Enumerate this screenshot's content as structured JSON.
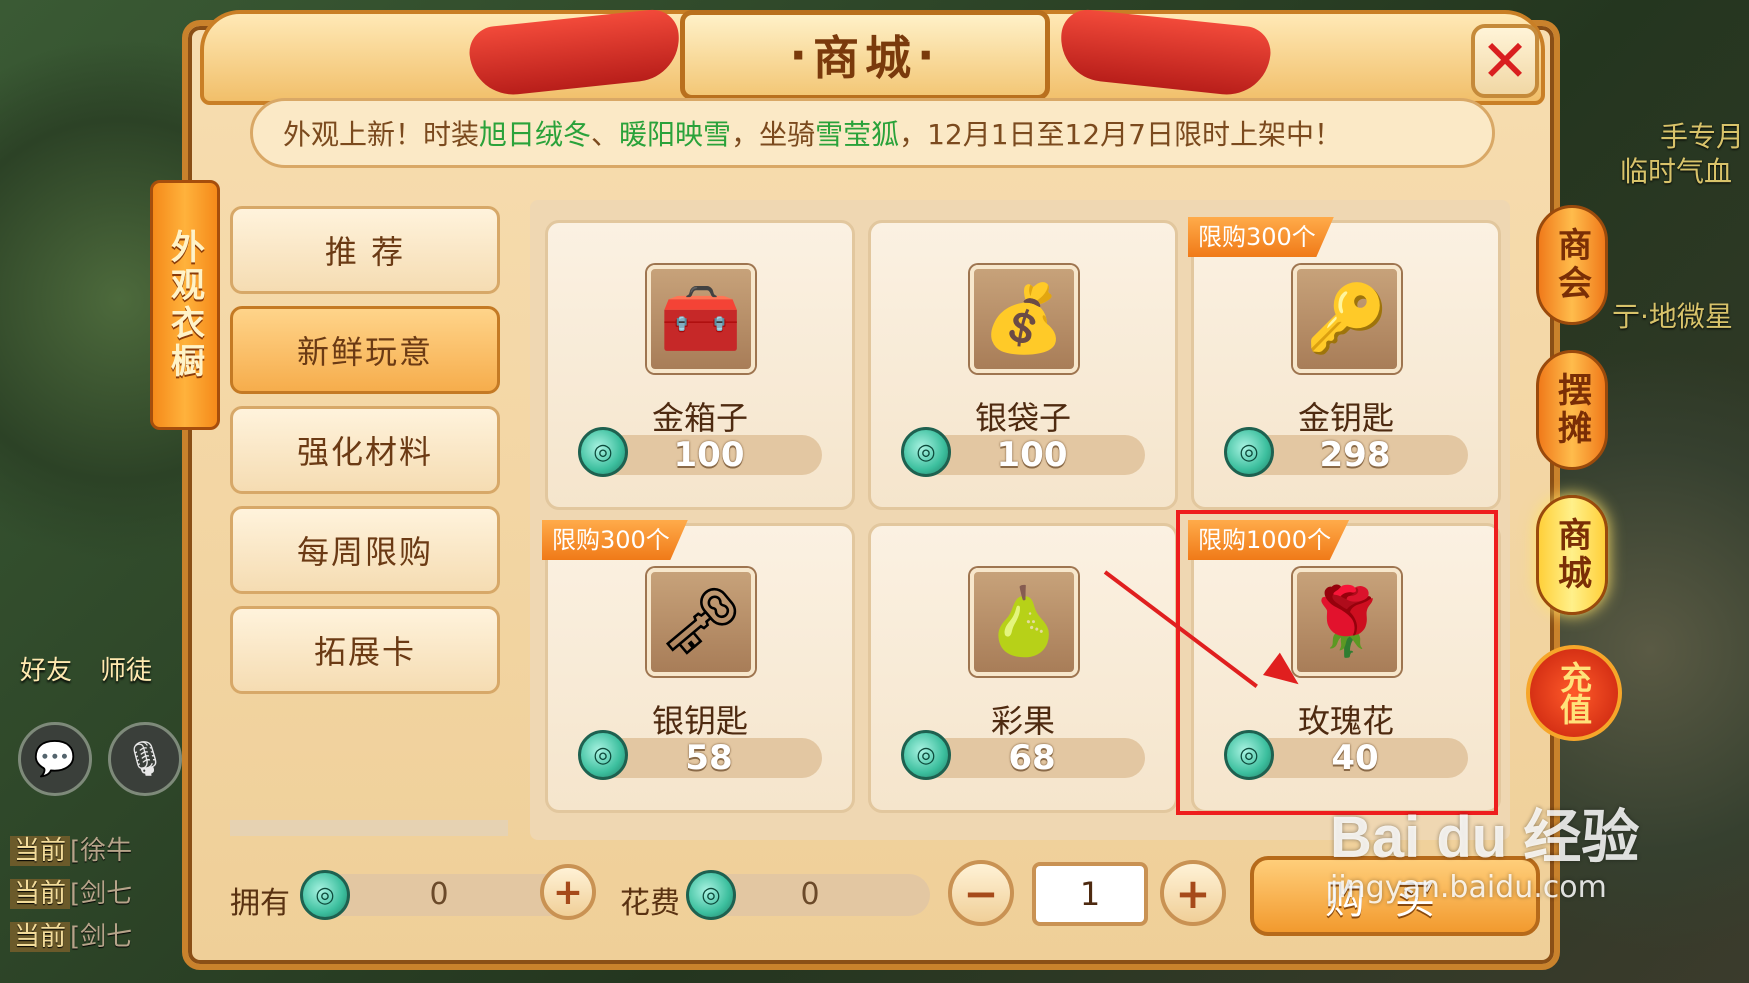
{
  "window": {
    "title": "商城",
    "close_glyph": "✕",
    "notice": {
      "prefix": "外观上新！时装",
      "item1": "旭日绒冬",
      "sep": "、",
      "item2": "暖阳映雪",
      "mid": "，坐骑",
      "item3": "雪莹狐",
      "suffix": "，12月1日至12月7日限时上架中！"
    },
    "side_tag": "外观衣橱"
  },
  "categories": [
    {
      "label": "推 荐",
      "active": false
    },
    {
      "label": "新鲜玩意",
      "active": true
    },
    {
      "label": "强化材料",
      "active": false
    },
    {
      "label": "每周限购",
      "active": false
    },
    {
      "label": "拓展卡",
      "active": false
    }
  ],
  "items": [
    {
      "name": "金箱子",
      "price": "100",
      "limit": "",
      "icon": "treasure-chest-icon",
      "glyph": "🧰"
    },
    {
      "name": "银袋子",
      "price": "100",
      "limit": "",
      "icon": "silver-bag-icon",
      "glyph": "💰"
    },
    {
      "name": "金钥匙",
      "price": "298",
      "limit": "限购300个",
      "icon": "gold-key-icon",
      "glyph": "🔑"
    },
    {
      "name": "银钥匙",
      "price": "58",
      "limit": "限购300个",
      "icon": "silver-key-icon",
      "glyph": "🗝"
    },
    {
      "name": "彩果",
      "price": "68",
      "limit": "",
      "icon": "rainbow-fruit-icon",
      "glyph": "🍐"
    },
    {
      "name": "玫瑰花",
      "price": "40",
      "limit": "限购1000个",
      "icon": "rose-icon",
      "glyph": "🌹"
    }
  ],
  "bottom": {
    "own_label": "拥有",
    "own_value": "0",
    "cost_label": "花费",
    "cost_value": "0",
    "quantity": "1",
    "minus": "−",
    "plus": "+",
    "buy_label": "购买"
  },
  "side_menu": [
    {
      "label": "商会",
      "active": false
    },
    {
      "label": "摆摊",
      "active": false
    },
    {
      "label": "商城",
      "active": true
    }
  ],
  "recharge_label": "充值",
  "hud": {
    "friends_label": "好友",
    "master_label": "师徒",
    "chat_lines": [
      {
        "tag": "当前",
        "text": "[徐牛"
      },
      {
        "tag": "当前",
        "text": "[剑七"
      },
      {
        "tag": "当前",
        "text": "[剑七"
      }
    ],
    "right_text_1": "手专月",
    "right_text_2": "临时气血",
    "right_text_3": "亍·地微星"
  },
  "watermark": {
    "line1": "Bai du 经验",
    "line2": "jingyan.baidu.com"
  },
  "colors": {
    "highlight": "#ee1d1d",
    "notice_highlight": "#2aa23a",
    "accent": "#f07a18"
  }
}
